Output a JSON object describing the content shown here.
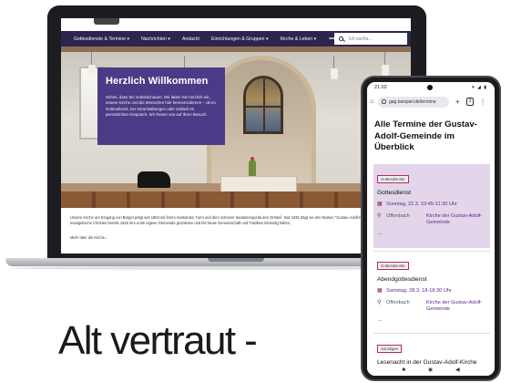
{
  "laptop": {
    "nav": {
      "items": [
        "Gottesdienste & Termine ▾",
        "Nachrichten ▾",
        "Andacht",
        "Einrichtungen & Gruppen ▾",
        "Kirche & Leben ▾"
      ],
      "more": "•••",
      "search_placeholder": "Ich suche..."
    },
    "welcome": {
      "title": "Herzlich Willkommen",
      "text": "Schön, dass Sie vorbeischauen. Wir laden Sie herzlich ein, unsere Kirche und die Menschen hier kennenzulernen – ob im Gottesdienst, bei Veranstaltungen oder einfach im persönlichen Gespräch. Wir freuen uns auf Ihren Besuch."
    },
    "intro": "Unsere Kirche am Eingang von Bürgel prägt seit 1903 mit ihrem markanten Turm und dem schönen Sandsteinportal den Ortsteil. Seit 1935 trägt sie den Namen \"Gustav-Adolf-Kirche\" – ein Ort, an dem evangelische Christen bereits 1915 ihre erste eigene Gemeinde gründeten und bis heute Gemeinschaft und Tradition lebendig halten.",
    "intro_more": "Mehr über die Kirche..."
  },
  "phone": {
    "status": {
      "time": "21:02",
      "icons": "▾ ◢ ▮"
    },
    "url": "gag.beispiel.de/termine",
    "tab_count": "3",
    "page_title": "Alle Termine der Gustav-Adolf-Gemeinde im Überblick",
    "events": [
      {
        "tag": "Gottesdienste",
        "title": "Gottesdienst",
        "date": "Sonntag, 22.3. 10:45-11:30 Uhr",
        "location_city": "Offenbach",
        "location_name": "Kirche der Gustav-Adolf-Gemeinde",
        "highlighted": true
      },
      {
        "tag": "Gottesdienste",
        "title": "Abendgottesdienst",
        "date": "Samstag, 28.3. 18-18:30 Uhr",
        "location_city": "Offenbach",
        "location_name": "Kirche der Gustav-Adolf-Gemeinde",
        "highlighted": false
      },
      {
        "tag": "Sonstiges",
        "title": "Lesenacht in der Gustav-Adolf-Kirche",
        "highlighted": false
      }
    ],
    "arrow": "→",
    "navbar": [
      "■",
      "◉",
      "◀"
    ]
  },
  "headline": "Alt vertraut -",
  "colors": {
    "nav_bg": "#2b2550",
    "welcome_bg": "#4b3b86",
    "event_highlight": "#e3d6ea",
    "tag_border": "#b52a5a",
    "link": "#5b2a8c"
  }
}
